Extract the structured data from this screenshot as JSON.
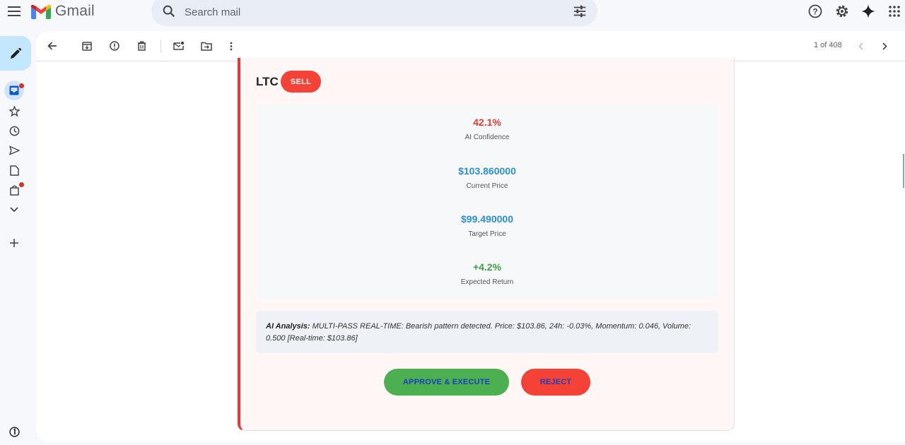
{
  "app": {
    "name": "Gmail"
  },
  "search": {
    "placeholder": "Search mail"
  },
  "toolbar": {
    "pager_text": "1 of 408"
  },
  "signal": {
    "ticker": "LTC",
    "action": "SELL",
    "stats": [
      {
        "value": "42.1%",
        "label": "AI Confidence",
        "color": "#e53935"
      },
      {
        "value": "$103.860000",
        "label": "Current Price",
        "color": "#2b8fd6"
      },
      {
        "value": "$99.490000",
        "label": "Target Price",
        "color": "#2b8fd6"
      },
      {
        "value": "+4.2%",
        "label": "Expected Return",
        "color": "#43a047"
      }
    ],
    "analysis_label": "AI Analysis:",
    "analysis_text": " MULTI-PASS REAL-TIME: Bearish pattern detected. Price: $103.86, 24h: -0.03%, Momentum: 0.046, Volume: 0.500 [Real-time: $103.86]",
    "approve_label": "APPROVE & EXECUTE",
    "reject_label": "REJECT"
  },
  "icons": {
    "menu": "menu-icon",
    "search": "search-icon",
    "tune": "tune-icon",
    "help": "help-icon",
    "settings": "gear-icon",
    "gemini": "sparkle-icon",
    "apps": "apps-grid-icon"
  }
}
